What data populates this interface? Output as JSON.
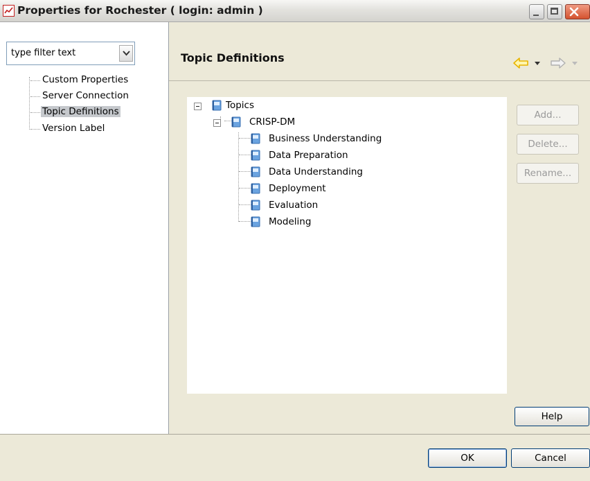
{
  "window": {
    "title": "Properties for Rochester ( login: admin )"
  },
  "filter": {
    "placeholder": "type filter text"
  },
  "nav": {
    "items": [
      {
        "label": "Custom Properties"
      },
      {
        "label": "Server Connection"
      },
      {
        "label": "Topic Definitions",
        "selected": true
      },
      {
        "label": "Version Label"
      }
    ]
  },
  "page": {
    "title": "Topic Definitions"
  },
  "tree": {
    "root": "Topics",
    "group": "CRISP-DM",
    "children": [
      "Business Understanding",
      "Data Preparation",
      "Data Understanding",
      "Deployment",
      "Evaluation",
      "Modeling"
    ]
  },
  "buttons": {
    "add": "Add...",
    "delete": "Delete...",
    "rename": "Rename...",
    "help": "Help",
    "ok": "OK",
    "cancel": "Cancel"
  },
  "colors": {
    "accent_arrow": "#e8b400",
    "selection": "#c5c8cc",
    "panel": "#ece9d8"
  }
}
